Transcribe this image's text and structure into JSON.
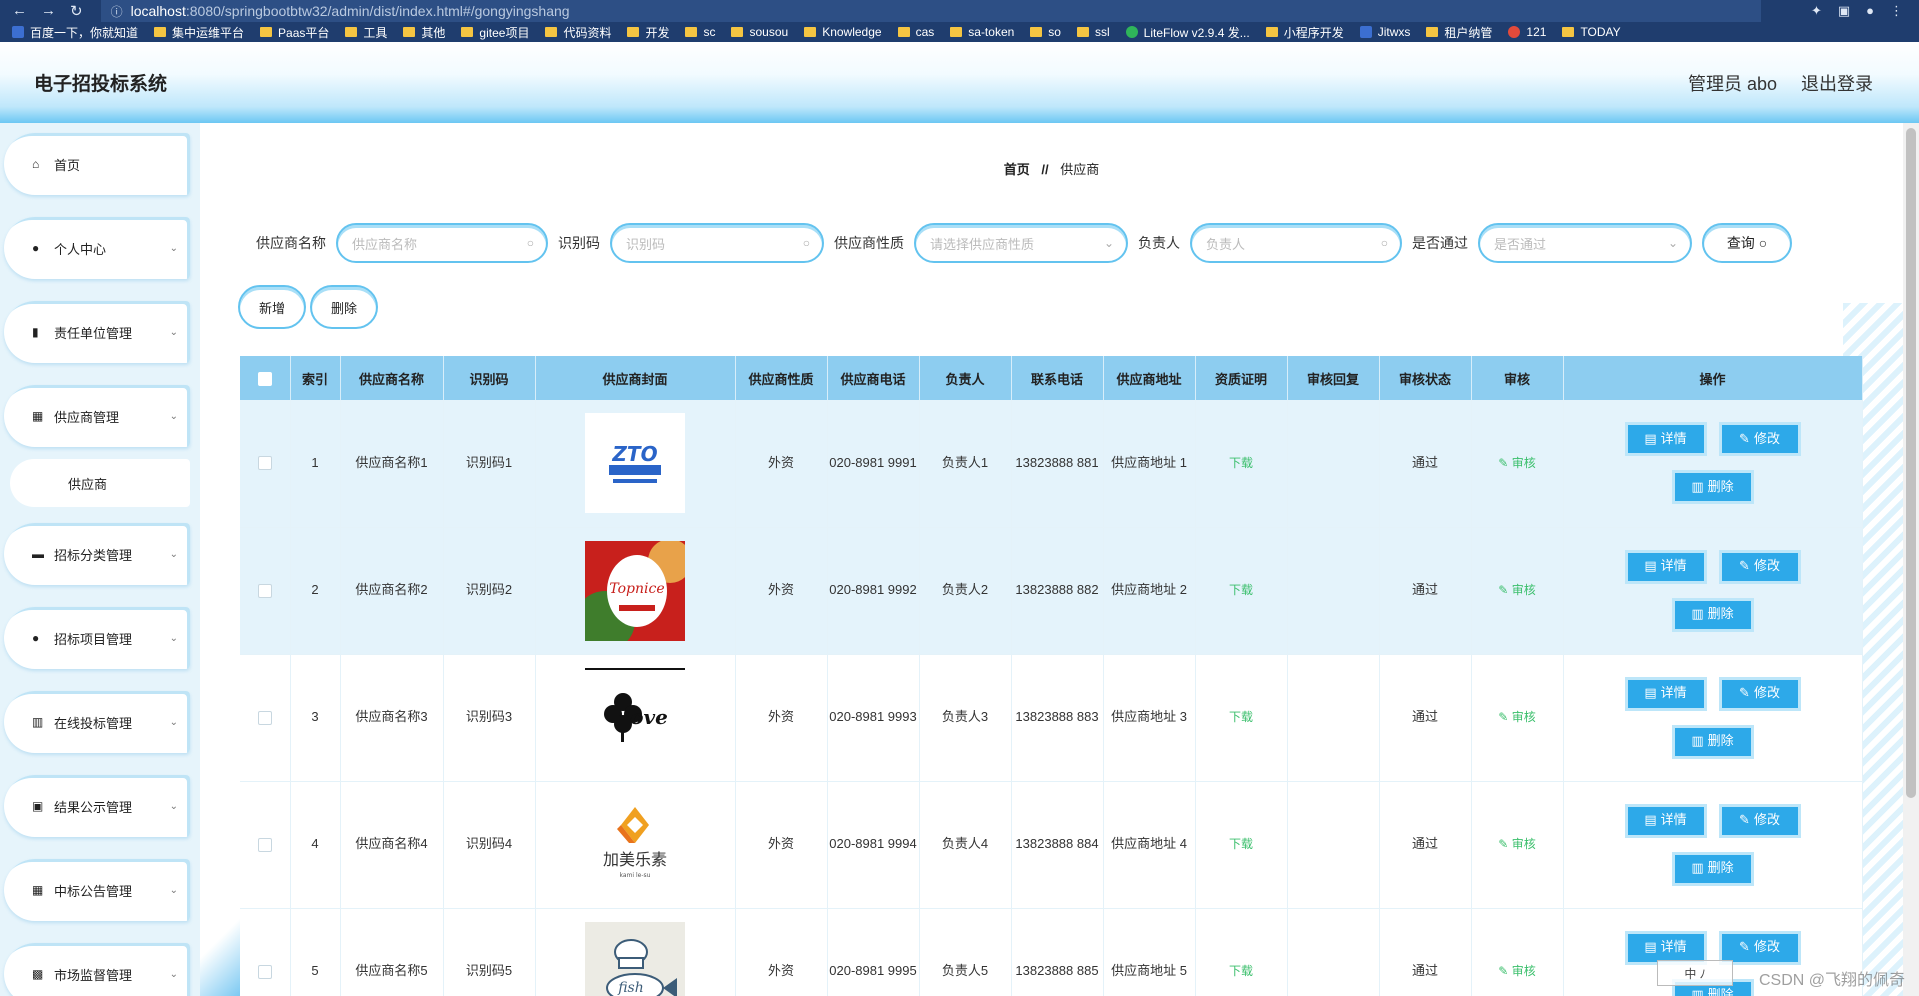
{
  "browser": {
    "url_host": "localhost",
    "url_path": ":8080/springbootbtw32/admin/dist/index.html#/gongyingshang",
    "bookmarks": [
      "百度一下，你就知道",
      "集中运维平台",
      "Paas平台",
      "工具",
      "其他",
      "gitee项目",
      "代码资料",
      "开发",
      "sc",
      "sousou",
      "Knowledge",
      "cas",
      "sa-token",
      "so",
      "ssl",
      "LiteFlow v2.9.4 发...",
      "小程序开发",
      "Jitwxs",
      "租户纳管",
      "121",
      "TODAY"
    ]
  },
  "header": {
    "title": "电子招投标系统",
    "user": "管理员 abo",
    "logout": "退出登录"
  },
  "sidebar": {
    "items": [
      {
        "label": "首页",
        "icon": "home-icon"
      },
      {
        "label": "个人中心",
        "icon": "user-icon"
      },
      {
        "label": "责任单位管理",
        "icon": "book-icon"
      },
      {
        "label": "供应商管理",
        "icon": "grid-icon"
      },
      {
        "label": "招标分类管理",
        "icon": "briefcase-icon"
      },
      {
        "label": "招标项目管理",
        "icon": "user-icon"
      },
      {
        "label": "在线投标管理",
        "icon": "bar-chart-icon"
      },
      {
        "label": "结果公示管理",
        "icon": "camera-icon"
      },
      {
        "label": "中标公告管理",
        "icon": "grid-icon"
      },
      {
        "label": "市场监督管理",
        "icon": "monitor-icon"
      }
    ],
    "submenu": "供应商"
  },
  "breadcrumb": {
    "home": "首页",
    "sep": "//",
    "current": "供应商"
  },
  "search": {
    "name_label": "供应商名称",
    "name_placeholder": "供应商名称",
    "code_label": "识别码",
    "code_placeholder": "识别码",
    "nature_label": "供应商性质",
    "nature_placeholder": "请选择供应商性质",
    "owner_label": "负责人",
    "owner_placeholder": "负责人",
    "pass_label": "是否通过",
    "pass_placeholder": "是否通过",
    "query_button": "查询"
  },
  "actions": {
    "add": "新增",
    "delete": "删除"
  },
  "table": {
    "headers": [
      "索引",
      "供应商名称",
      "识别码",
      "供应商封面",
      "供应商性质",
      "供应商电话",
      "负责人",
      "联系电话",
      "供应商地址",
      "资质证明",
      "审核回复",
      "审核状态",
      "审核",
      "操作"
    ],
    "download_label": "下载",
    "audit_label": "审核",
    "detail_label": "详情",
    "edit_label": "修改",
    "delete_label": "删除",
    "rows": [
      {
        "index": "1",
        "name": "供应商名称1",
        "code": "识别码1",
        "cover": "ZTO 中通快递",
        "nature": "外资",
        "phone": "020-8981 9991",
        "owner": "负责人1",
        "mobile": "13823888 881",
        "address": "供应商地址 1",
        "reply": "",
        "status": "通过"
      },
      {
        "index": "2",
        "name": "供应商名称2",
        "code": "识别码2",
        "cover": "Topnice",
        "nature": "外资",
        "phone": "020-8981 9992",
        "owner": "负责人2",
        "mobile": "13823888 882",
        "address": "供应商地址 2",
        "reply": "",
        "status": "通过"
      },
      {
        "index": "3",
        "name": "供应商名称3",
        "code": "识别码3",
        "cover": "Love",
        "nature": "外资",
        "phone": "020-8981 9993",
        "owner": "负责人3",
        "mobile": "13823888 883",
        "address": "供应商地址 3",
        "reply": "",
        "status": "通过"
      },
      {
        "index": "4",
        "name": "供应商名称4",
        "code": "识别码4",
        "cover": "加美乐素",
        "nature": "外资",
        "phone": "020-8981 9994",
        "owner": "负责人4",
        "mobile": "13823888 884",
        "address": "供应商地址 4",
        "reply": "",
        "status": "通过"
      },
      {
        "index": "5",
        "name": "供应商名称5",
        "code": "识别码5",
        "cover": "fish",
        "nature": "外资",
        "phone": "020-8981 9995",
        "owner": "负责人5",
        "mobile": "13823888 885",
        "address": "供应商地址 5",
        "reply": "",
        "status": "通过"
      }
    ]
  },
  "watermark": "CSDN @飞翔的佩奇",
  "ime_badge": "中 ﾉ"
}
